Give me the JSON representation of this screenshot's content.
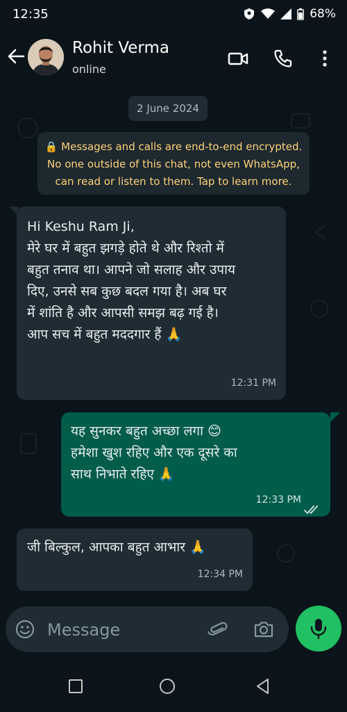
{
  "status_bar": {
    "time": "12:35",
    "battery": "68%",
    "icons": [
      "shield-icon",
      "wifi-icon",
      "signal-icon",
      "battery-icon"
    ]
  },
  "header": {
    "contact_name": "Rohit Verma",
    "contact_status": "online",
    "icons": [
      "back-arrow-icon",
      "video-call-icon",
      "voice-call-icon",
      "more-options-icon"
    ]
  },
  "chat": {
    "date_chip": "2 June 2024",
    "encryption_notice": [
      "🔒 Messages and calls are end-to-end encrypted.",
      "No one outside of this chat, not even WhatsApp,",
      "can read or listen to them. Tap to learn more."
    ],
    "messages": [
      {
        "direction": "incoming",
        "lines": [
          "Hi Keshu Ram Ji,",
          "मेरे घर में बहुत झगड़े होते थे और रिश्तो में",
          "बहुत तनाव था। आपने जो सलाह और उपाय",
          "दिए, उनसे सब कुछ बदल गया है। अब घर",
          "में शांति है और आपसी समझ बढ़ गई है।",
          "आप सच में बहुत मददगार हैं 🙏"
        ],
        "time": "12:31 PM"
      },
      {
        "direction": "outgoing",
        "lines": [
          "यह सुनकर बहुत अच्छा लगा 😊",
          "हमेशा खुश रहिए और एक दूसरे का",
          "साथ निभाते रहिए 🙏"
        ],
        "time": "12:33 PM",
        "status": "read"
      },
      {
        "direction": "incoming",
        "lines": [
          "जी बिल्कुल, आपका बहुत आभार 🙏"
        ],
        "time": "12:34 PM"
      }
    ]
  },
  "composer": {
    "placeholder": "Message",
    "icons": [
      "emoji-icon",
      "attach-icon",
      "camera-icon",
      "mic-icon"
    ]
  },
  "nav_bar": {
    "icons": [
      "recents-square-icon",
      "home-circle-icon",
      "back-triangle-icon"
    ]
  },
  "colors": {
    "background": "#0b141a",
    "incoming_bubble": "#1f2c34",
    "outgoing_bubble": "#005c4b",
    "encryption_text": "#ffd279",
    "mic_button": "#21c063"
  }
}
